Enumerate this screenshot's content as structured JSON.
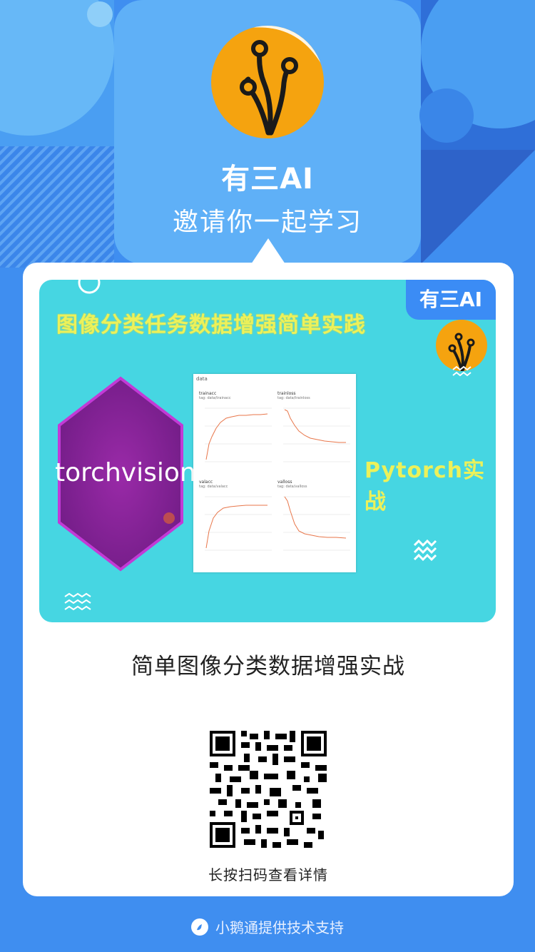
{
  "header": {
    "brand": "有三AI",
    "invite": "邀请你一起学习",
    "logo_icon": "tree-branch-logo-icon"
  },
  "card": {
    "cover": {
      "title": "图像分类任务数据增强简单实践",
      "brand_tag": "有三AI",
      "framework_logo": "torchvision",
      "subtitle": "Pytorch实战",
      "charts": [
        {
          "name": "trainacc",
          "tag": "tag: data/trainacc"
        },
        {
          "name": "trainloss",
          "tag": "tag: data/trainloss"
        },
        {
          "name": "valacc",
          "tag": "tag: data/valacc"
        },
        {
          "name": "valloss",
          "tag": "tag: data/valloss"
        }
      ],
      "screenshot_tab": "data"
    },
    "caption": "简单图像分类数据增强实战",
    "qr_icon": "qr-code-icon",
    "scan_hint": "长按扫码查看详情"
  },
  "footer": {
    "text": "小鹅通提供技术支持",
    "icon": "xiaoe-logo-icon"
  },
  "colors": {
    "background": "#3f8ef0",
    "cover_bg": "#46d6e2",
    "accent_yellow": "#ecf15a",
    "logo_orange": "#f5a30f",
    "hex_purple": "#8a2a9c"
  }
}
